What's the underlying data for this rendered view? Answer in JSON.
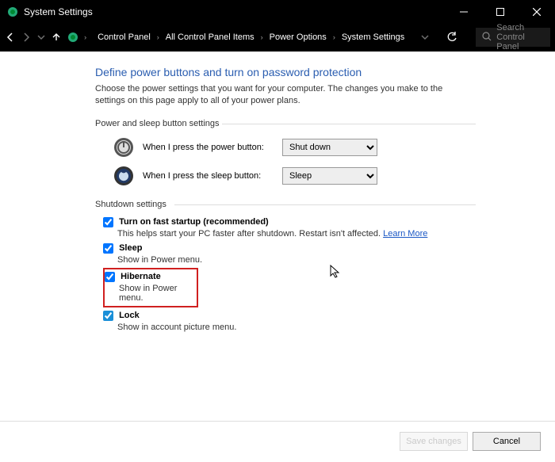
{
  "window": {
    "title": "System Settings"
  },
  "breadcrumb": {
    "items": [
      "Control Panel",
      "All Control Panel Items",
      "Power Options",
      "System Settings"
    ]
  },
  "search": {
    "placeholder": "Search Control Panel"
  },
  "page": {
    "title": "Define power buttons and turn on password protection",
    "desc": "Choose the power settings that you want for your computer. The changes you make to the settings on this page apply to all of your power plans."
  },
  "groups": {
    "buttons_label": "Power and sleep button settings",
    "shutdown_label": "Shutdown settings"
  },
  "rows": {
    "power_label": "When I press the power button:",
    "power_value": "Shut down",
    "sleep_label": "When I press the sleep button:",
    "sleep_value": "Sleep"
  },
  "shutdown": {
    "fast": {
      "label": "Turn on fast startup (recommended)",
      "desc_a": "This helps start your PC faster after shutdown. Restart isn't affected. ",
      "learn": "Learn More"
    },
    "sleep": {
      "label": "Sleep",
      "desc": "Show in Power menu."
    },
    "hibernate": {
      "label": "Hibernate",
      "desc": "Show in Power menu."
    },
    "lock": {
      "label": "Lock",
      "desc": "Show in account picture menu."
    }
  },
  "footer": {
    "save": "Save changes",
    "cancel": "Cancel"
  }
}
